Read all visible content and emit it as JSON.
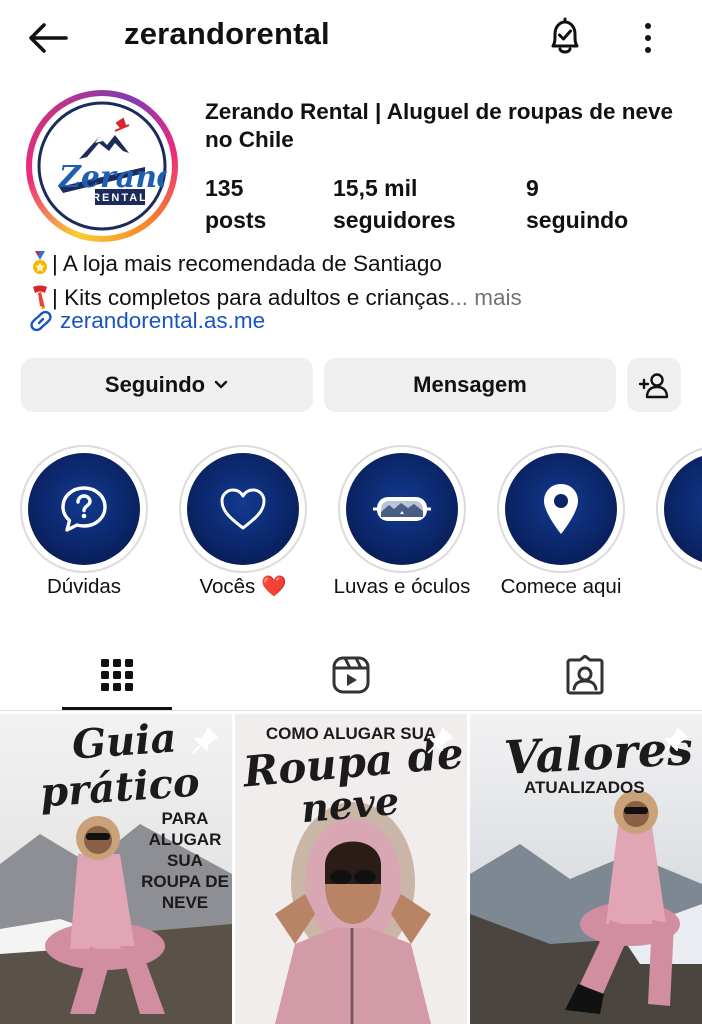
{
  "header": {
    "username": "zerandorental"
  },
  "profile": {
    "logo_text": "Zerando",
    "logo_sub": "RENTAL",
    "full_name": "Zerando Rental | Aluguel de roupas de neve no Chile",
    "stats": [
      {
        "num": "135",
        "label": "posts"
      },
      {
        "num": "15,5 mil",
        "label": "seguidores"
      },
      {
        "num": "9",
        "label": "seguindo"
      }
    ],
    "bio_line1": "| A loja mais recomendada de Santiago",
    "bio_line2": "| Kits completos para adultos e crianças",
    "bio_more": "... mais",
    "link": "zerandorental.as.me"
  },
  "actions": {
    "following": "Seguindo",
    "message": "Mensagem"
  },
  "highlights": [
    {
      "label": "Dúvidas",
      "icon": "question-icon"
    },
    {
      "label": "Vocês ❤️",
      "icon": "heart-icon"
    },
    {
      "label": "Luvas e óculos",
      "icon": "goggles-icon"
    },
    {
      "label": "Comece aqui",
      "icon": "location-pin-icon"
    },
    {
      "label": "",
      "icon": "ski-icon"
    }
  ],
  "posts": [
    {
      "line1": "Guia",
      "line2": "prático",
      "sub": "PARA ALUGAR SUA ROUPA DE NEVE"
    },
    {
      "top": "COMO ALUGAR SUA",
      "line1": "Roupa de",
      "line2": "neve"
    },
    {
      "line1": "Valores",
      "sub": "ATUALIZADOS"
    }
  ],
  "colors": {
    "link": "#1a54c4",
    "highlight_fill": "#0b2466",
    "button_bg": "#efefef",
    "muted": "#737373"
  }
}
